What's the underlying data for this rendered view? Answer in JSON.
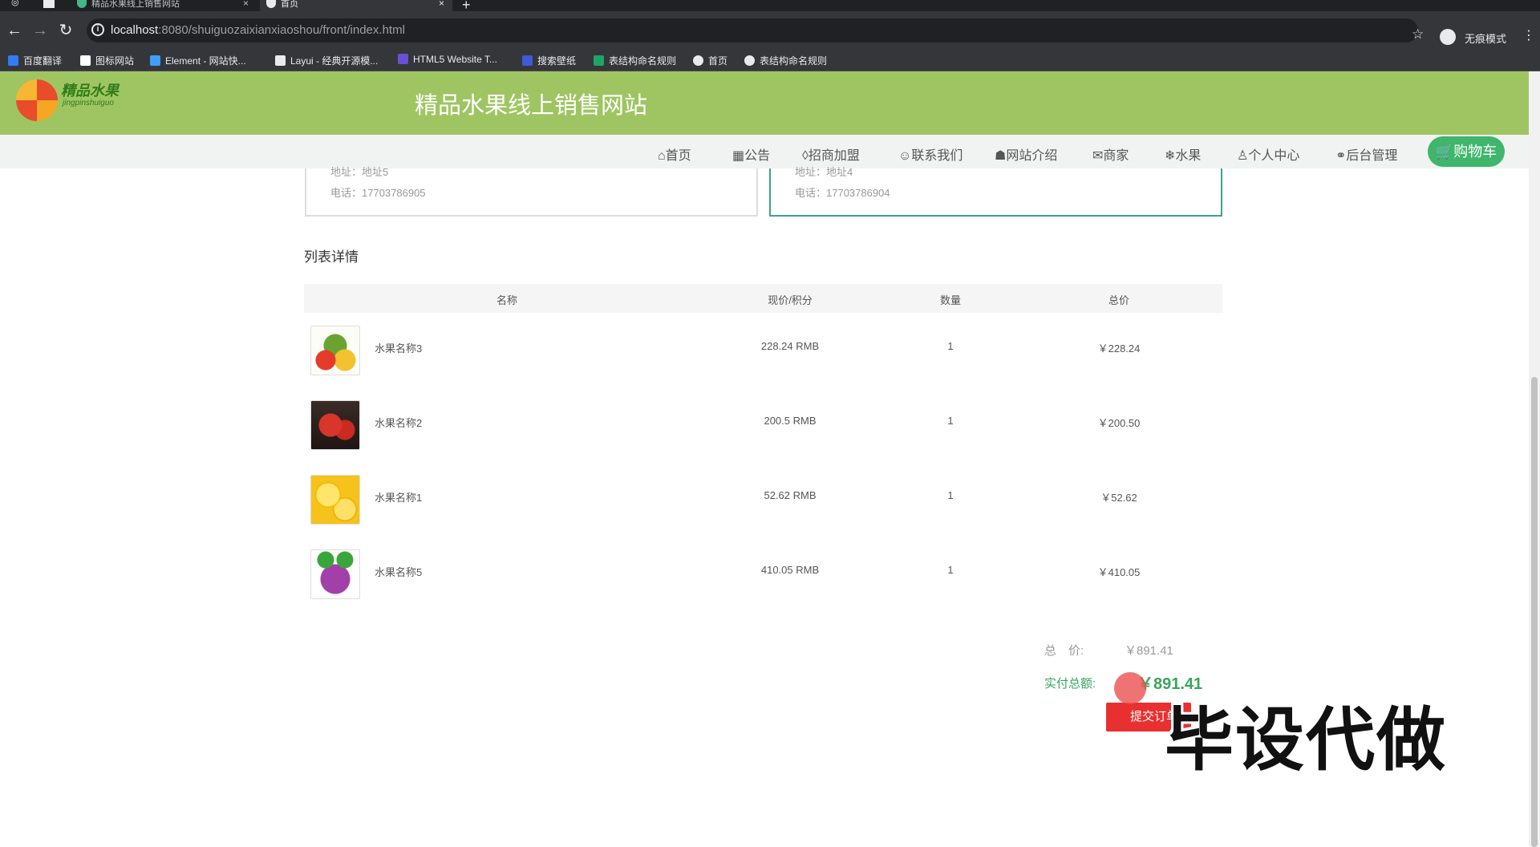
{
  "browser": {
    "tabs": [
      {
        "title": "精品水果线上销售网站"
      },
      {
        "title": "首页"
      }
    ],
    "new_tab": "+",
    "url_host": "localhost",
    "url_rest": ":8080/shuiguozaixianxiaoshou/front/index.html",
    "incognito_label": "无痕模式",
    "bookmarks": [
      {
        "label": "百度翻译",
        "color": "#2f7cf6"
      },
      {
        "label": "图标网站",
        "color": "#ffffff"
      },
      {
        "label": "Element - 网站快...",
        "color": "#409eff"
      },
      {
        "label": "Layui - 经典开源模...",
        "color": "#e8eaed"
      },
      {
        "label": "HTML5 Website T...",
        "color": "#6b4fd6"
      },
      {
        "label": "搜索壁纸",
        "color": "#3c5bd6"
      },
      {
        "label": "表结构命名规则",
        "color": "#21a366"
      },
      {
        "label": "首页",
        "color": "#e8eaed"
      },
      {
        "label": "表结构命名规则",
        "color": "#e8eaed"
      }
    ]
  },
  "site": {
    "logo_text": "精品水果",
    "logo_sub": "jingpinshuiguo",
    "title": "精品水果线上销售网站",
    "nav": [
      {
        "label": "首页",
        "icon": "home-icon",
        "glyph": "⌂"
      },
      {
        "label": "公告",
        "icon": "notice-icon",
        "glyph": "▦"
      },
      {
        "label": "招商加盟",
        "icon": "tag-icon",
        "glyph": "◊"
      },
      {
        "label": "联系我们",
        "icon": "smile-icon",
        "glyph": "☺"
      },
      {
        "label": "网站介绍",
        "icon": "graduation-icon",
        "glyph": "☗"
      },
      {
        "label": "商家",
        "icon": "mail-icon",
        "glyph": "✉"
      },
      {
        "label": "水果",
        "icon": "snowflake-icon",
        "glyph": "❄"
      },
      {
        "label": "个人中心",
        "icon": "user-icon",
        "glyph": "♙"
      },
      {
        "label": "后台管理",
        "icon": "link-icon",
        "glyph": "⚭"
      }
    ],
    "cart_label": "购物车"
  },
  "addresses": [
    {
      "address": "地址：地址5",
      "phone": "电话：17703786905"
    },
    {
      "address": "地址：地址4",
      "phone": "电话：17703786904"
    }
  ],
  "section_title": "列表详情",
  "table": {
    "headers": [
      "名称",
      "现价/积分",
      "数量",
      "总价"
    ],
    "rows": [
      {
        "name": "水果名称3",
        "price": "228.24 RMB",
        "qty": "1",
        "total": "￥228.24",
        "img": "fruit-basket"
      },
      {
        "name": "水果名称2",
        "price": "200.5 RMB",
        "qty": "1",
        "total": "￥200.50",
        "img": "strawberry"
      },
      {
        "name": "水果名称1",
        "price": "52.62 RMB",
        "qty": "1",
        "total": "￥52.62",
        "img": "lemon"
      },
      {
        "name": "水果名称5",
        "price": "410.05 RMB",
        "qty": "1",
        "total": "￥410.05",
        "img": "grape"
      }
    ]
  },
  "summary": {
    "total_label": "总　价:",
    "total_value": "￥891.41",
    "paid_label": "实付总额:",
    "paid_value": "￥891.41",
    "submit_label": "提交订单"
  },
  "watermark": "毕设代做",
  "colors": {
    "header_green": "#9fc562",
    "cart_green": "#3fb66c",
    "paid_green": "#3aa55d",
    "submit_red": "#e83030"
  }
}
